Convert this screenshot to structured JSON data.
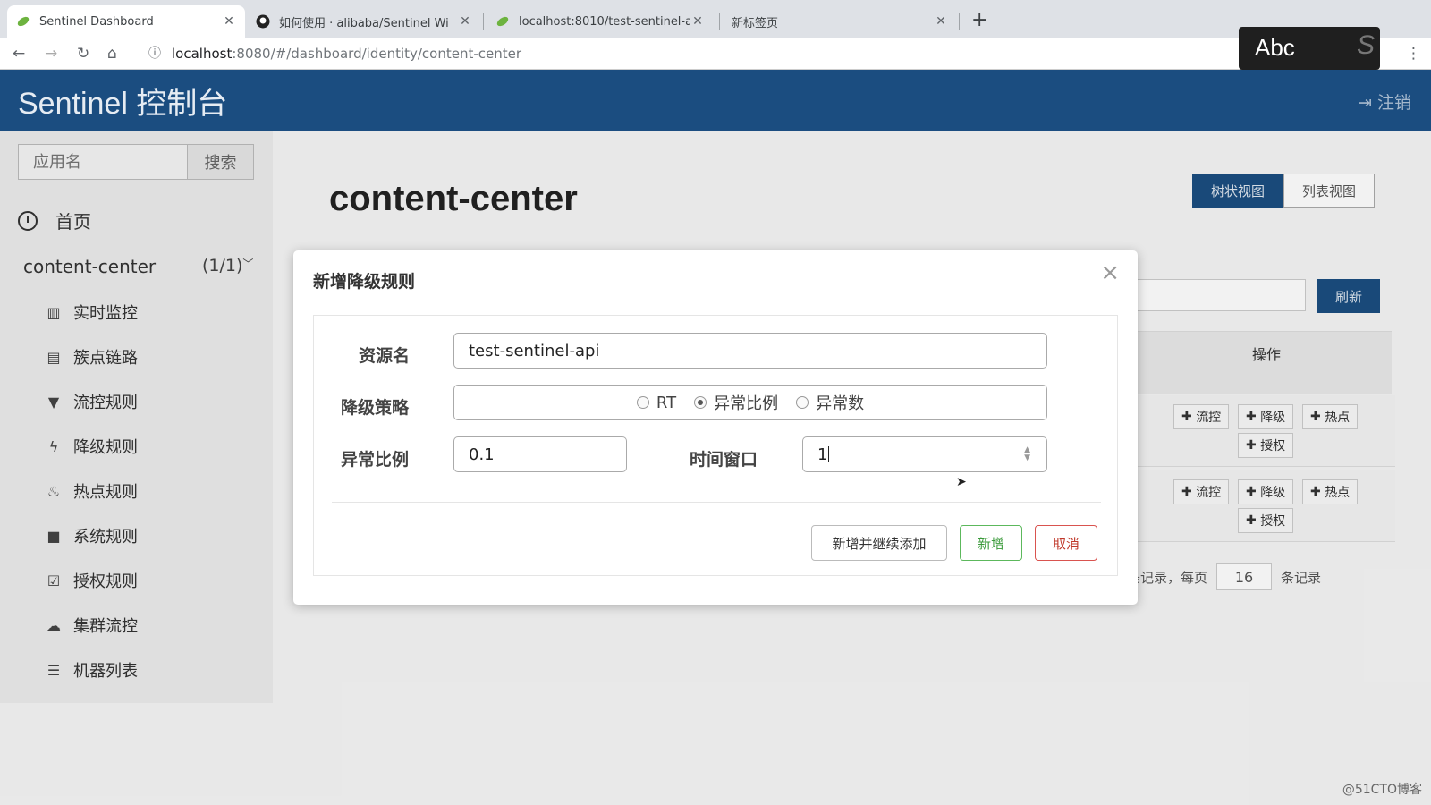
{
  "browser": {
    "tabs": [
      {
        "title": "Sentinel Dashboard",
        "icon": "leaf-icon"
      },
      {
        "title": "如何使用 · alibaba/Sentinel Wi",
        "icon": "github-icon"
      },
      {
        "title": "localhost:8010/test-sentinel-a",
        "icon": "leaf-icon"
      },
      {
        "title": "新标签页",
        "icon": ""
      }
    ],
    "new_tab": "+",
    "url_host": "localhost",
    "url_path": ":8080/#/dashboard/identity/content-center"
  },
  "ime": {
    "label": "Abc"
  },
  "header": {
    "brand": "Sentinel 控制台",
    "logout": "注销"
  },
  "sidebar": {
    "search_placeholder": "应用名",
    "search_button": "搜索",
    "home": "首页",
    "app_name": "content-center",
    "app_count": "(1/1)",
    "items": [
      {
        "label": "实时监控",
        "icon": "bar-chart-icon"
      },
      {
        "label": "簇点链路",
        "icon": "list-alt-icon"
      },
      {
        "label": "流控规则",
        "icon": "filter-icon"
      },
      {
        "label": "降级规则",
        "icon": "flash-icon"
      },
      {
        "label": "热点规则",
        "icon": "fire-icon"
      },
      {
        "label": "系统规则",
        "icon": "lock-icon"
      },
      {
        "label": "授权规则",
        "icon": "check-icon"
      },
      {
        "label": "集群流控",
        "icon": "cloud-icon"
      },
      {
        "label": "机器列表",
        "icon": "th-list-icon"
      }
    ]
  },
  "main": {
    "title": "content-center",
    "view_tree": "树状视图",
    "view_list": "列表视图",
    "refresh": "刷新",
    "ops_header": "操作",
    "op_buttons": [
      "流控",
      "降级",
      "热点",
      "授权"
    ],
    "pager_pre": "条记录，每页",
    "pager_size": "16",
    "pager_post": "条记录"
  },
  "modal": {
    "title": "新增降级规则",
    "close": "×",
    "resource_label": "资源名",
    "resource_value": "test-sentinel-api",
    "strategy_label": "降级策略",
    "strategies": [
      "RT",
      "异常比例",
      "异常数"
    ],
    "selected_strategy": "异常比例",
    "ratio_label": "异常比例",
    "ratio_value": "0.1",
    "window_label": "时间窗口",
    "window_value": "1",
    "btn_add_continue": "新增并继续添加",
    "btn_add": "新增",
    "btn_cancel": "取消"
  },
  "watermark": "@51CTO博客"
}
